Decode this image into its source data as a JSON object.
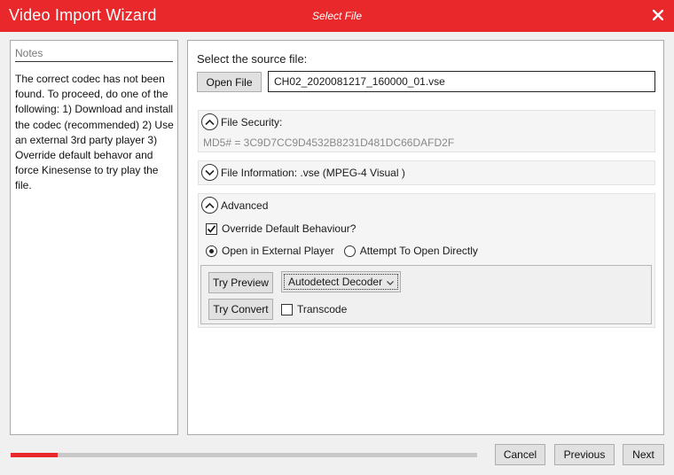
{
  "window": {
    "app_title": "Video Import Wizard",
    "step_title": "Select File",
    "close_icon": "close-icon"
  },
  "notes": {
    "header": "Notes",
    "text": "The correct codec has not been found. To proceed, do one of the following: 1) Download and install the codec (recommended) 2) Use an external 3rd party player 3) Override default  behavor and force Kinesense to try play the file."
  },
  "source": {
    "label": "Select the source file:",
    "open_file_label": "Open File",
    "file_path": "CH02_2020081217_160000_01.vse"
  },
  "file_security": {
    "title": "File Security:",
    "md5": "MD5# = 3C9D7CC9D4532B8231D481DC66DAFD2F",
    "expanded": true
  },
  "file_information": {
    "title": "File Information: .vse (MPEG-4 Visual )",
    "expanded": false
  },
  "advanced": {
    "title": "Advanced",
    "expanded": true,
    "override_label": "Override Default Behaviour?",
    "override_checked": true,
    "radio_external": "Open in External Player",
    "radio_direct": "Attempt To Open Directly",
    "selected_mode": "external",
    "try_preview_label": "Try Preview",
    "try_convert_label": "Try Convert",
    "decoder_selected": "Autodetect Decoder",
    "transcode_label": "Transcode",
    "transcode_checked": false
  },
  "footer": {
    "progress_fraction": 0.1,
    "cancel_label": "Cancel",
    "previous_label": "Previous",
    "next_label": "Next"
  },
  "colors": {
    "accent": "#e8282b",
    "panel_bg": "#ffffff",
    "window_bg": "#f0f0f0"
  }
}
